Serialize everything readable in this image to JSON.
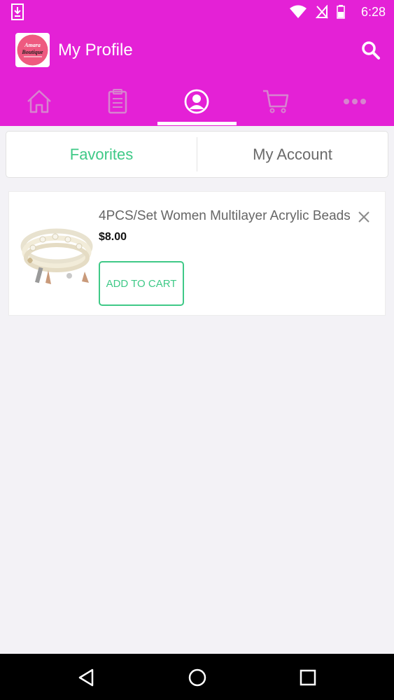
{
  "status_bar": {
    "time": "6:28",
    "icons": [
      "download-icon",
      "wifi-icon",
      "no-signal-icon",
      "battery-icon"
    ]
  },
  "app_bar": {
    "logo_text_line1": "Amara",
    "logo_text_line2": "Boutique",
    "title": "My Profile",
    "search_icon": "search-icon"
  },
  "nav": {
    "items": [
      {
        "icon": "home-icon",
        "active": false
      },
      {
        "icon": "clipboard-icon",
        "active": false
      },
      {
        "icon": "profile-icon",
        "active": true
      },
      {
        "icon": "cart-icon",
        "active": false
      },
      {
        "icon": "more-icon",
        "active": false
      }
    ]
  },
  "tabs": {
    "favorites": "Favorites",
    "account": "My Account"
  },
  "favorites": [
    {
      "title": "4PCS/Set Women Multilayer Acrylic Beads",
      "price": "$8.00",
      "action": "ADD TO CART"
    }
  ],
  "colors": {
    "brand": "#e421d6",
    "accent": "#3fc987",
    "background": "#f3f2f6"
  }
}
